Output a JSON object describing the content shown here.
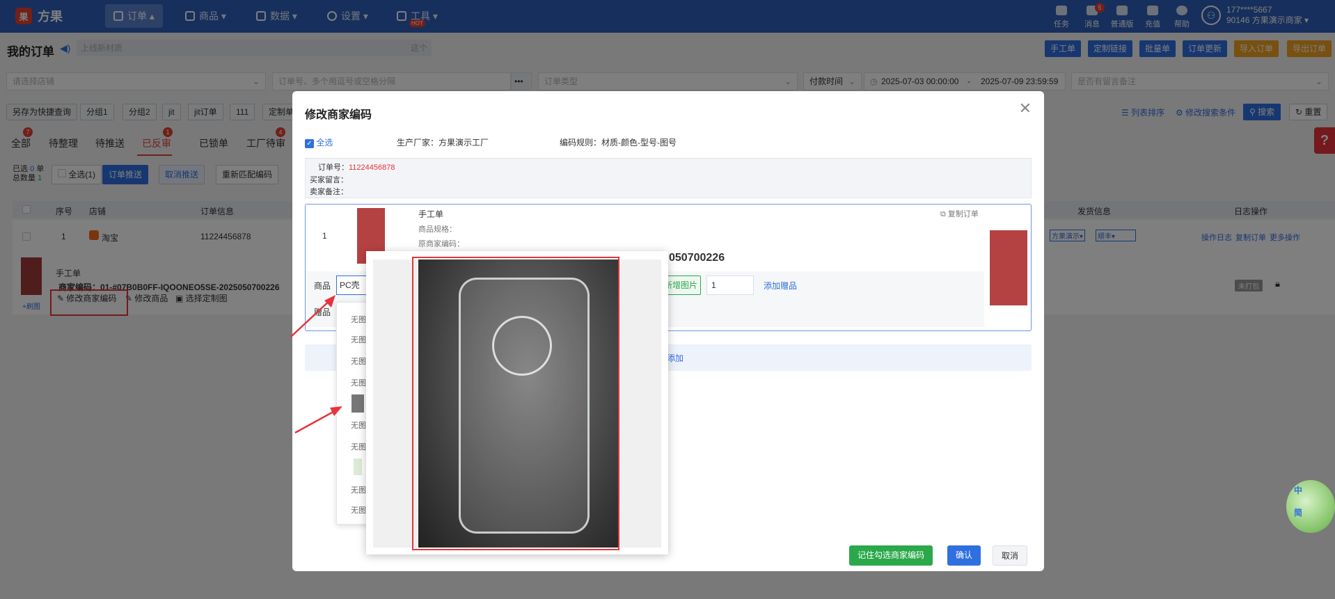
{
  "nav": {
    "brand": "方果",
    "items": [
      {
        "label": "订单 ▴",
        "active": true
      },
      {
        "label": "商品 ▾"
      },
      {
        "label": "数据 ▾"
      },
      {
        "label": "设置 ▾"
      },
      {
        "label": "工具 ▾",
        "badge": "HOT"
      }
    ],
    "right": [
      {
        "label": "任务"
      },
      {
        "label": "消息",
        "badge": "5"
      },
      {
        "label": "普通版"
      },
      {
        "label": "充值"
      },
      {
        "label": "帮助"
      }
    ],
    "user": {
      "phone": "177****5667",
      "account": "90146 方果演示商家 ▾"
    }
  },
  "header": {
    "title": "我的订单",
    "notice": "上线新材质",
    "notice_tail": "这个",
    "buttons": [
      "手工单",
      "定制链接",
      "批量单",
      "订单更新"
    ],
    "orange_buttons": [
      "导入订单",
      "导出订单"
    ]
  },
  "filters": {
    "shop_placeholder": "请选择店铺",
    "order_placeholder": "订单号、多个用逗号或空格分隔",
    "more": "•••",
    "type_placeholder": "订单类型",
    "time_field": "付款时间",
    "start": "2025-07-03 00:00:00",
    "dash": "-",
    "end": "2025-07-09 23:59:59",
    "remark_placeholder": "是否有留言备注"
  },
  "groups": {
    "save": "另存为快捷查询",
    "chips": [
      "分组1",
      "分组2",
      "jit",
      "jit订单",
      "111",
      "定制单"
    ],
    "right": [
      "列表排序",
      "修改搜索条件"
    ],
    "search": "搜索",
    "reset": "重置"
  },
  "tabs": [
    {
      "label": "全部",
      "badge": "7"
    },
    {
      "label": "待整理"
    },
    {
      "label": "待推送"
    },
    {
      "label": "已反审",
      "badge": "1",
      "active": true
    },
    {
      "label": "已锁单"
    },
    {
      "label": "工厂待审",
      "badge": "4"
    }
  ],
  "toolbar": {
    "selected": "已选",
    "selected_count": "0",
    "unit": "单",
    "total": "总数量",
    "total_count": "1",
    "check_all": "全选(1)",
    "push": "订单推送",
    "cancel_push": "取消推送",
    "rematch": "重新匹配编码"
  },
  "table": {
    "headers": [
      "序号",
      "店铺",
      "订单信息",
      "发货信息",
      "日志操作"
    ],
    "row": {
      "index": "1",
      "shop": "淘宝",
      "order_no": "11224456878",
      "factory": "方果演示▾",
      "express": "顺丰▾",
      "ops": [
        "操作日志",
        "复制订单",
        "更多操作"
      ],
      "status": "未打包"
    },
    "item": {
      "title": "手工单",
      "code_label": "商家编码：",
      "code": "01-#07B0B0FF-IQOONEO5SE-2025050700226",
      "actions": [
        "修改商家编码",
        "修改商品",
        "选择定制图"
      ],
      "add_img": "+刷图"
    }
  },
  "modal": {
    "title": "修改商家编码",
    "check_all": "全选",
    "factory_label": "生产厂家：",
    "factory": "方果演示工厂",
    "rule_label": "编码规则：",
    "rule": "材质-颜色-型号-图号",
    "order_no_label": "订单号：",
    "order_no": "11224456878",
    "buyer_msg": "买家留言：",
    "seller_note": "卖家备注：",
    "item_index": "1",
    "item_title": "手工单",
    "spec_label": "商品规格：",
    "orig_code_label": "原商家编码：",
    "code_tail": "050700226",
    "copy": "复制订单",
    "product_label": "商品",
    "product_input": "PC壳",
    "add_image": "新增图片",
    "qty": "1",
    "add_gift": "添加赠品",
    "gift_label": "赠品",
    "add": "添加",
    "remember": "记住勾选商家编码",
    "confirm": "确认",
    "cancel": "取消"
  },
  "dropdown": {
    "items": [
      "无图",
      "无图",
      "无图",
      "无图",
      "",
      "无图",
      "无图",
      "",
      "无图",
      "无图"
    ]
  },
  "ime": {
    "a": "中",
    "b": "简"
  },
  "help": "?"
}
